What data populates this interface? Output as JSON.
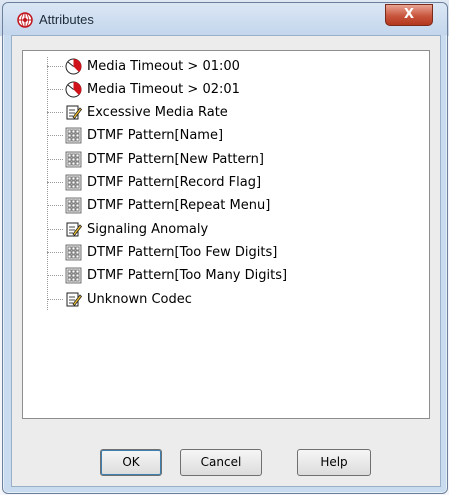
{
  "dialog": {
    "title": "Attributes",
    "close_label": "X"
  },
  "tree": {
    "items": [
      {
        "label": "Media Timeout > 01:00",
        "icon": "timer-icon"
      },
      {
        "label": "Media Timeout > 02:01",
        "icon": "timer-icon"
      },
      {
        "label": "Excessive Media Rate",
        "icon": "edit-document-icon"
      },
      {
        "label": "DTMF Pattern[Name]",
        "icon": "keypad-icon"
      },
      {
        "label": "DTMF Pattern[New Pattern]",
        "icon": "keypad-icon"
      },
      {
        "label": "DTMF Pattern[Record Flag]",
        "icon": "keypad-icon"
      },
      {
        "label": "DTMF Pattern[Repeat Menu]",
        "icon": "keypad-icon"
      },
      {
        "label": "Signaling Anomaly",
        "icon": "edit-document-icon"
      },
      {
        "label": "DTMF Pattern[Too Few Digits]",
        "icon": "keypad-icon"
      },
      {
        "label": "DTMF Pattern[Too Many Digits]",
        "icon": "keypad-icon"
      },
      {
        "label": "Unknown Codec",
        "icon": "edit-document-icon"
      }
    ]
  },
  "buttons": {
    "ok": "OK",
    "cancel": "Cancel",
    "help": "Help"
  },
  "colors": {
    "accent": "#3c7fb1",
    "close": "#c8553d",
    "timer_red": "#d0121b"
  }
}
